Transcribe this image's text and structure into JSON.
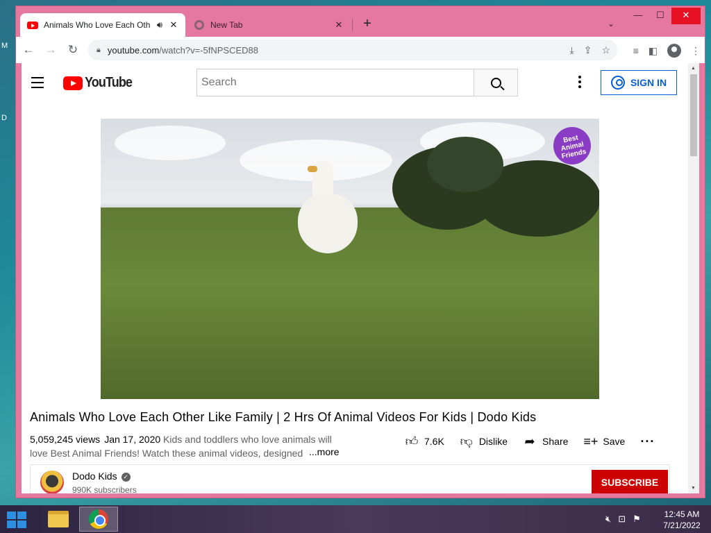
{
  "desktop": {
    "edge_letters": [
      "M",
      "D"
    ]
  },
  "browser": {
    "tabs": [
      {
        "title": "Animals Who Love Each Other Like Family",
        "icon": "youtube-favicon",
        "audio_icon": "speaker-icon",
        "active": true
      },
      {
        "title": "New Tab",
        "icon": "chrome-favicon",
        "active": false
      }
    ],
    "url_host": "youtube.com",
    "url_path": "/watch?v=-5fNPSCED88",
    "window_controls": [
      "minimize",
      "maximize",
      "close"
    ]
  },
  "youtube": {
    "logo_text": "YouTube",
    "search_placeholder": "Search",
    "sign_in_label": "SIGN IN",
    "video": {
      "badge_text": "Best Animal Friends",
      "title": "Animals Who Love Each Other Like Family | 2 Hrs Of Animal Videos For Kids | Dodo Kids",
      "views": "5,059,245 views",
      "date": "Jan 17, 2020",
      "description_line1": "Kids and toddlers who love animals will",
      "description_line2": "love Best Animal Friends! Watch these animal videos, designed",
      "more_label": "...more",
      "likes": "7.6K",
      "dislike_label": "Dislike",
      "share_label": "Share",
      "save_label": "Save"
    },
    "channel": {
      "name": "Dodo Kids",
      "subscribers": "990K subscribers",
      "subscribe_label": "SUBSCRIBE"
    }
  },
  "taskbar": {
    "time": "12:45 AM",
    "date": "7/21/2022",
    "apps": [
      "file-explorer",
      "google-chrome"
    ]
  },
  "colors": {
    "window_frame": "#e4789e",
    "youtube_red": "#ff0000",
    "subscribe_red": "#cc0000",
    "signin_blue": "#065fd4"
  }
}
